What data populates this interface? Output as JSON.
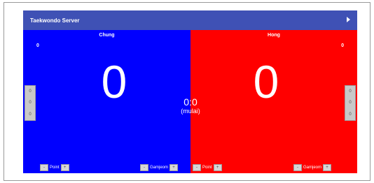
{
  "app": {
    "title": "Taekwondo Server"
  },
  "players": {
    "blue": {
      "name": "Chung",
      "penalty": "0",
      "score": "0",
      "side_buttons": [
        "0",
        "0",
        "0"
      ],
      "point_label": "Point",
      "gamjeom_label": "Gamjeom"
    },
    "red": {
      "name": "Hong",
      "penalty": "0",
      "score": "0",
      "side_buttons": [
        "0",
        "0",
        "0"
      ],
      "point_label": "Point",
      "gamjeom_label": "Gamjeom"
    }
  },
  "timer": {
    "time": "0:0",
    "state": "(mulai)"
  },
  "buttons": {
    "minus": "-",
    "plus": "+"
  },
  "colors": {
    "appbar": "#3f51b5",
    "blue": "#0000ff",
    "red": "#ff0000"
  }
}
